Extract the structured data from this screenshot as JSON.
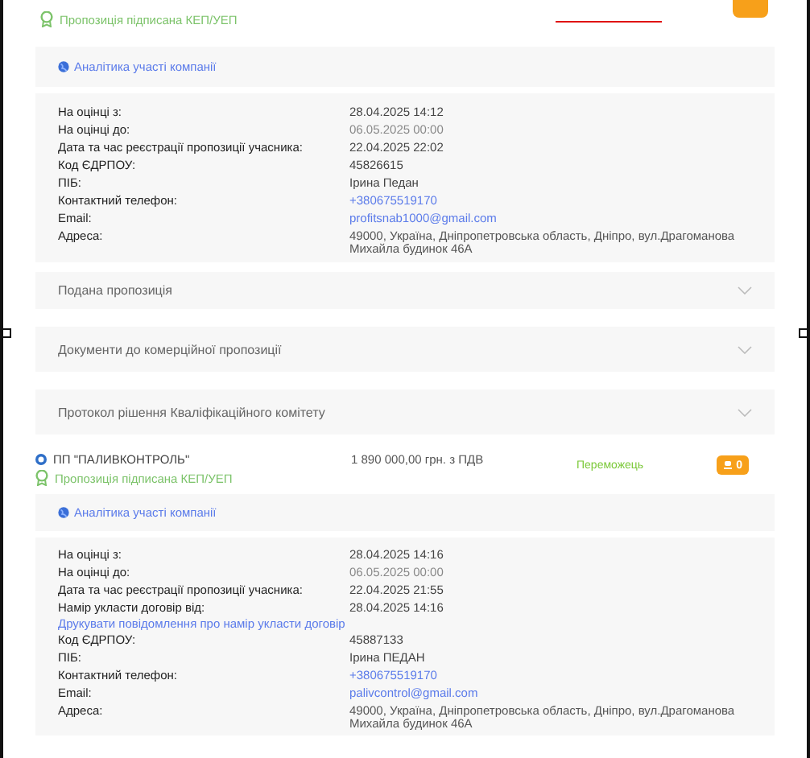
{
  "bids": [
    {
      "signed": "Пропозиція підписана КЕП/УЕП",
      "analytics": "Аналітика участі компанії",
      "details": [
        {
          "kind": "text",
          "label": "На оцінці з:",
          "value": "28.04.2025 14:12"
        },
        {
          "kind": "muted",
          "label": "На оцінці до:",
          "value": "06.05.2025 00:00"
        },
        {
          "kind": "text",
          "label": "Дата та час реєстрації пропозиції учасника:",
          "value": "22.04.2025 22:02"
        },
        {
          "kind": "text",
          "label": "Код ЄДРПОУ:",
          "value": "45826615"
        },
        {
          "kind": "text",
          "label": "ПІБ:",
          "value": "Ірина Педан"
        },
        {
          "kind": "link",
          "label": "Контактний телефон:",
          "value": "+380675519170"
        },
        {
          "kind": "link",
          "label": "Email:",
          "value": "profitsnab1000@gmail.com"
        },
        {
          "kind": "text",
          "label": "Адреса:",
          "value": "49000, Україна, Дніпропетровська область, Дніпро, вул.Драгоманова Михайла будинок 46А"
        }
      ],
      "sections": [
        {
          "title": "Подана пропозиція",
          "expanded": false
        },
        {
          "title": "Документи до комерційної пропозиції",
          "expanded": false
        },
        {
          "title": "Протокол рішення Кваліфікаційного комітету",
          "expanded": false
        }
      ]
    },
    {
      "company": "ПП \"ПАЛИВКОНТРОЛЬ\"",
      "price": "1 890 000,00 грн. з ПДВ",
      "status": "Переможець",
      "count": "0",
      "signed": "Пропозиція підписана КЕП/УЕП",
      "analytics": "Аналітика участі компанії",
      "details": [
        {
          "kind": "text",
          "label": "На оцінці з:",
          "value": "28.04.2025 14:16"
        },
        {
          "kind": "muted",
          "label": "На оцінці до:",
          "value": "06.05.2025 00:00"
        },
        {
          "kind": "text",
          "label": "Дата та час реєстрації пропозиції учасника:",
          "value": "22.04.2025 21:55"
        },
        {
          "kind": "text",
          "label": "Намір укласти договір від:",
          "value": "28.04.2025 14:16"
        },
        {
          "kind": "action",
          "label": "Друкувати повідомлення про намір укласти договір"
        },
        {
          "kind": "text",
          "label": "Код ЄДРПОУ:",
          "value": "45887133"
        },
        {
          "kind": "text",
          "label": "ПІБ:",
          "value": "Ірина ПЕДАН"
        },
        {
          "kind": "link",
          "label": "Контактний телефон:",
          "value": "+380675519170"
        },
        {
          "kind": "link",
          "label": "Email:",
          "value": "palivcontrol@gmail.com"
        },
        {
          "kind": "text",
          "label": "Адреса:",
          "value": "49000, Україна, Дніпропетровська область, Дніпро, вул.Драгоманова Михайла будинок 46А"
        }
      ]
    }
  ]
}
